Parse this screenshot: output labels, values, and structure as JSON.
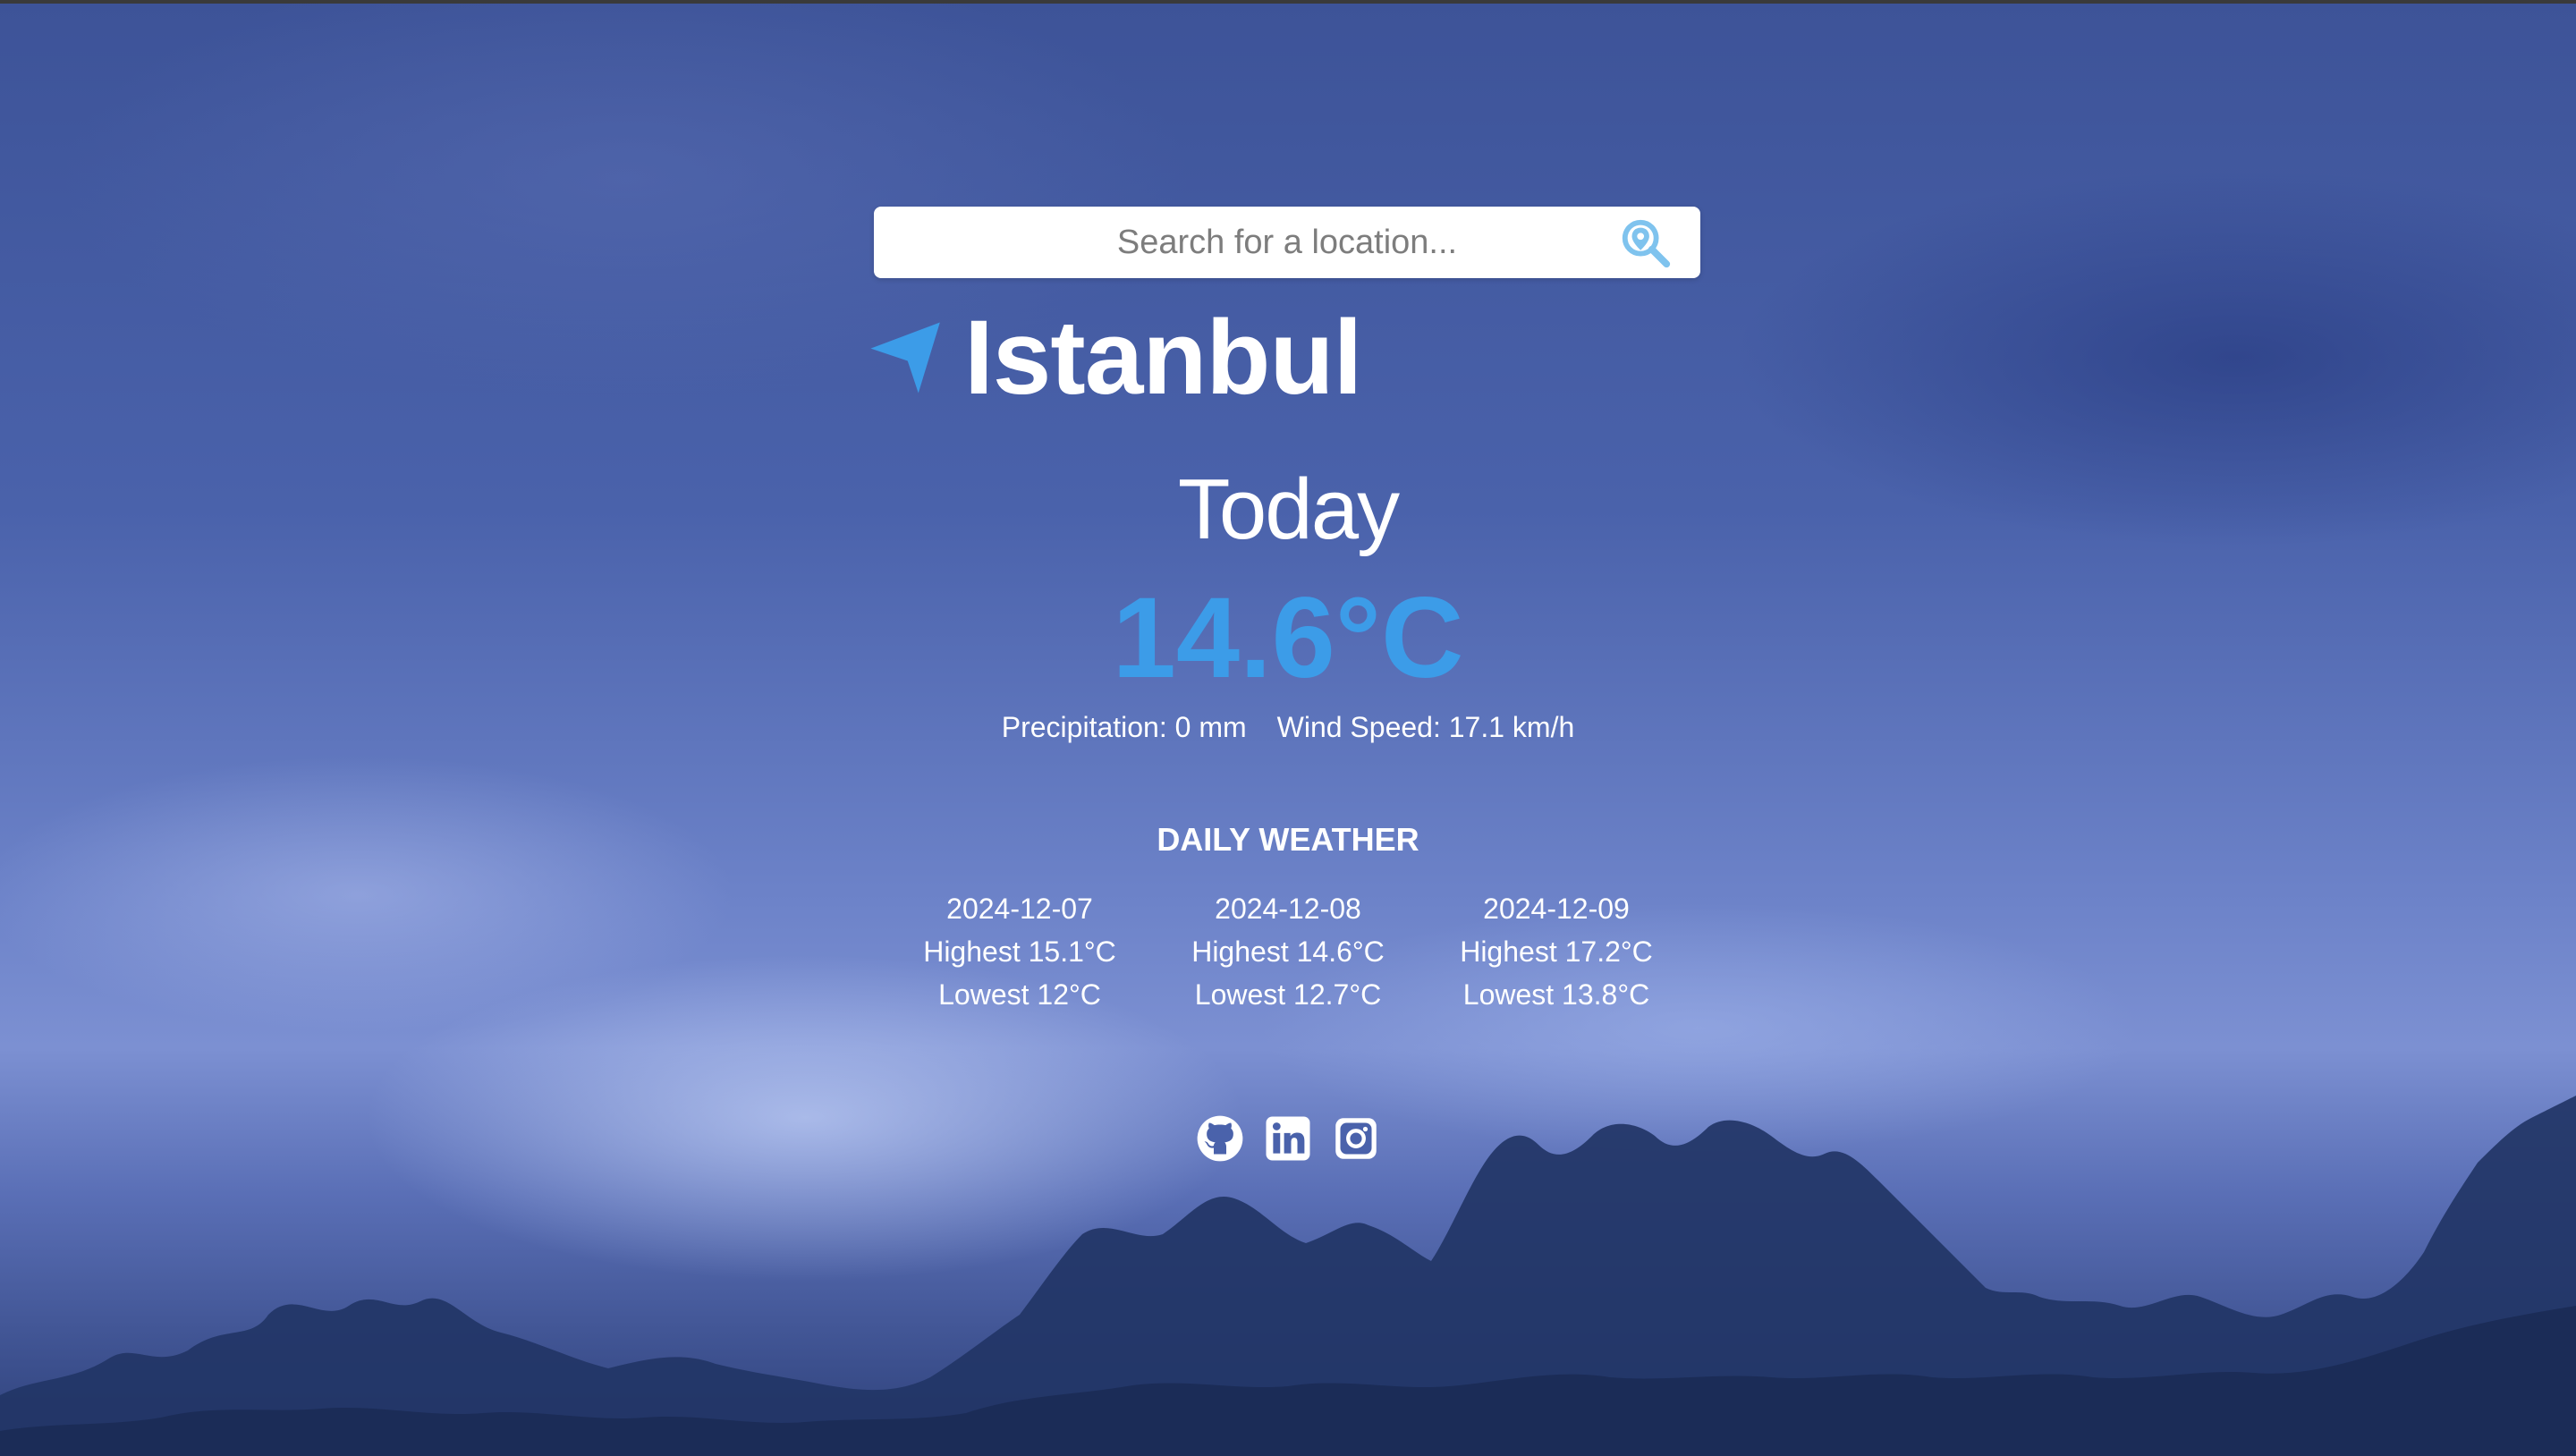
{
  "search": {
    "placeholder": "Search for a location...",
    "icon": "search-location-icon"
  },
  "location": {
    "icon": "location-arrow-icon",
    "city": "Istanbul"
  },
  "current": {
    "label": "Today",
    "temperature": "14.6°C",
    "precipitation": "Precipitation: 0 mm",
    "wind_speed": "Wind Speed: 17.1 km/h"
  },
  "daily": {
    "title": "DAILY WEATHER",
    "days": [
      {
        "date": "2024-12-07",
        "highest": "Highest 15.1°C",
        "lowest": "Lowest 12°C"
      },
      {
        "date": "2024-12-08",
        "highest": "Highest 14.6°C",
        "lowest": "Lowest 12.7°C"
      },
      {
        "date": "2024-12-09",
        "highest": "Highest 17.2°C",
        "lowest": "Lowest 13.8°C"
      }
    ]
  },
  "socials": [
    {
      "icon": "github-icon"
    },
    {
      "icon": "linkedin-icon"
    },
    {
      "icon": "instagram-icon"
    }
  ],
  "colors": {
    "accent": "#3c9ce8",
    "text": "#ffffff",
    "sky": "#4a62ab"
  }
}
